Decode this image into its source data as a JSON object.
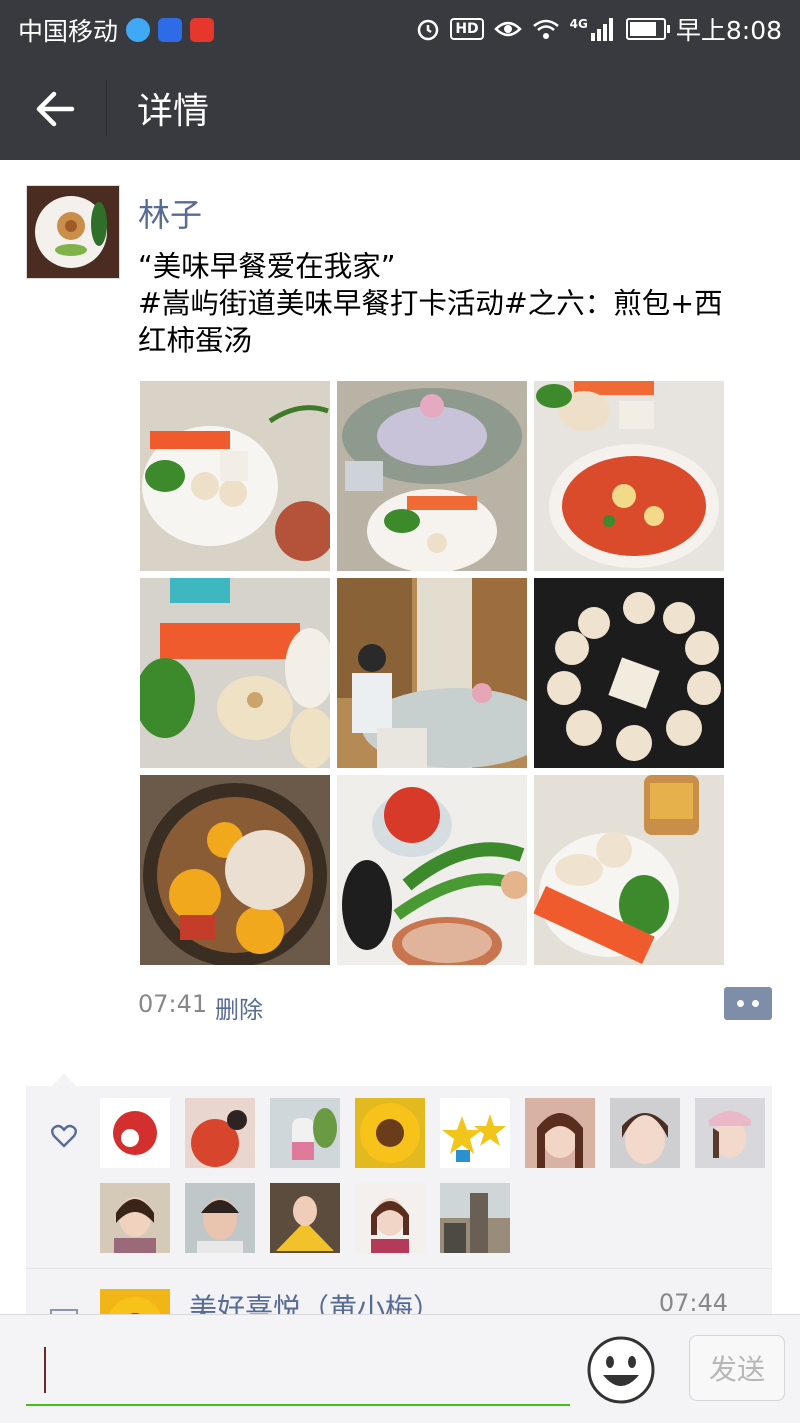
{
  "status_bar": {
    "carrier": "中国移动",
    "network": "4G",
    "hd_label": "HD",
    "time": "早上8:08"
  },
  "title_bar": {
    "title": "详情"
  },
  "post": {
    "author": "林子",
    "text_line1": "“美味早餐爱在我家”",
    "text_line2": "#嵩屿街道美味早餐打卡活动#之六：煎包+西",
    "text_line3": "红柿蛋汤",
    "photo_count": 9,
    "time": "07:41",
    "delete_label": "删除"
  },
  "likes": {
    "liker_count": 13
  },
  "comment": {
    "name": "美好喜悦（黄小梅）",
    "time": "07:44"
  },
  "input_bar": {
    "send_label": "发送"
  },
  "colors": {
    "bar_bg": "#393a3f",
    "link": "#576b95",
    "input_underline": "#45c01a",
    "like_bg": "#f3f3f5"
  }
}
